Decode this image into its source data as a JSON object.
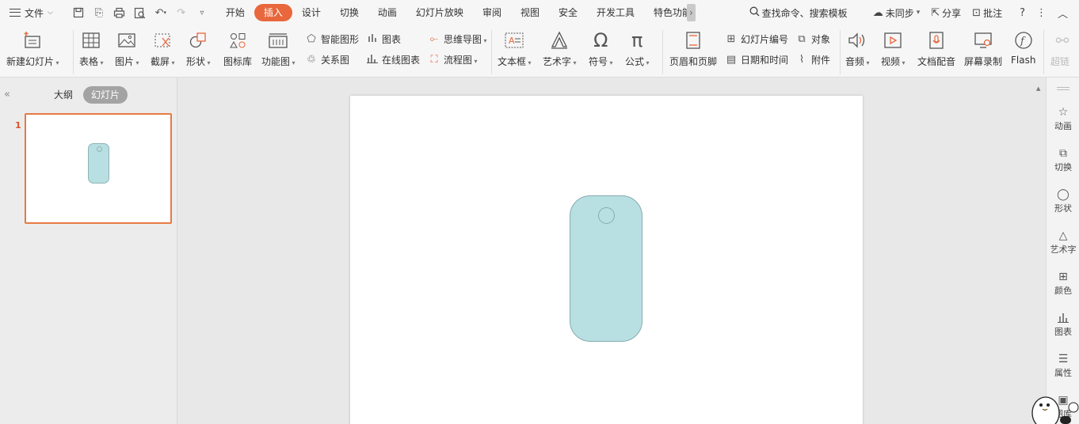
{
  "menubar": {
    "file_label": "文件",
    "tabs": [
      {
        "label": "开始",
        "active": false
      },
      {
        "label": "插入",
        "active": true
      },
      {
        "label": "设计",
        "active": false
      },
      {
        "label": "切换",
        "active": false
      },
      {
        "label": "动画",
        "active": false
      },
      {
        "label": "幻灯片放映",
        "active": false
      },
      {
        "label": "审阅",
        "active": false
      },
      {
        "label": "视图",
        "active": false
      },
      {
        "label": "安全",
        "active": false
      },
      {
        "label": "开发工具",
        "active": false
      },
      {
        "label": "特色功能",
        "active": false
      }
    ],
    "search_label": "查找命令、搜索模板",
    "sync_label": "未同步",
    "share_label": "分享",
    "comment_label": "批注"
  },
  "ribbon": {
    "new_slide": "新建幻灯片",
    "table": "表格",
    "picture": "图片",
    "screenshot": "截屏",
    "shape": "形状",
    "icon_lib": "图标库",
    "function_chart": "功能图",
    "smart_shape": "智能图形",
    "chart": "图表",
    "relation": "关系图",
    "online_chart": "在线图表",
    "mindmap": "思维导图",
    "flowchart": "流程图",
    "textbox": "文本框",
    "wordart": "艺术字",
    "symbol": "符号",
    "formula": "公式",
    "header_footer": "页眉和页脚",
    "slide_number": "幻灯片编号",
    "object": "对象",
    "date_time": "日期和时间",
    "attachment": "附件",
    "audio": "音频",
    "video": "视频",
    "doc_voice": "文档配音",
    "screen_record": "屏幕录制",
    "flash": "Flash",
    "hyperlink": "超链"
  },
  "left_panel": {
    "tab_outline": "大纲",
    "tab_slides": "幻灯片",
    "slides": [
      {
        "number": "1"
      }
    ]
  },
  "right_panel": {
    "items": [
      {
        "label": "动画",
        "icon": "star-icon"
      },
      {
        "label": "切换",
        "icon": "transition-icon"
      },
      {
        "label": "形状",
        "icon": "shape-icon"
      },
      {
        "label": "艺术字",
        "icon": "wordart-icon"
      },
      {
        "label": "颜色",
        "icon": "color-grid-icon"
      },
      {
        "label": "图表",
        "icon": "chart-icon"
      },
      {
        "label": "属性",
        "icon": "properties-icon"
      },
      {
        "label": "图库",
        "icon": "gallery-icon"
      }
    ]
  },
  "canvas": {
    "shape_fill": "#b8e0e2",
    "shape_stroke": "#86abae"
  },
  "colors": {
    "accent": "#e8673c",
    "thumb_border": "#e57a43"
  }
}
